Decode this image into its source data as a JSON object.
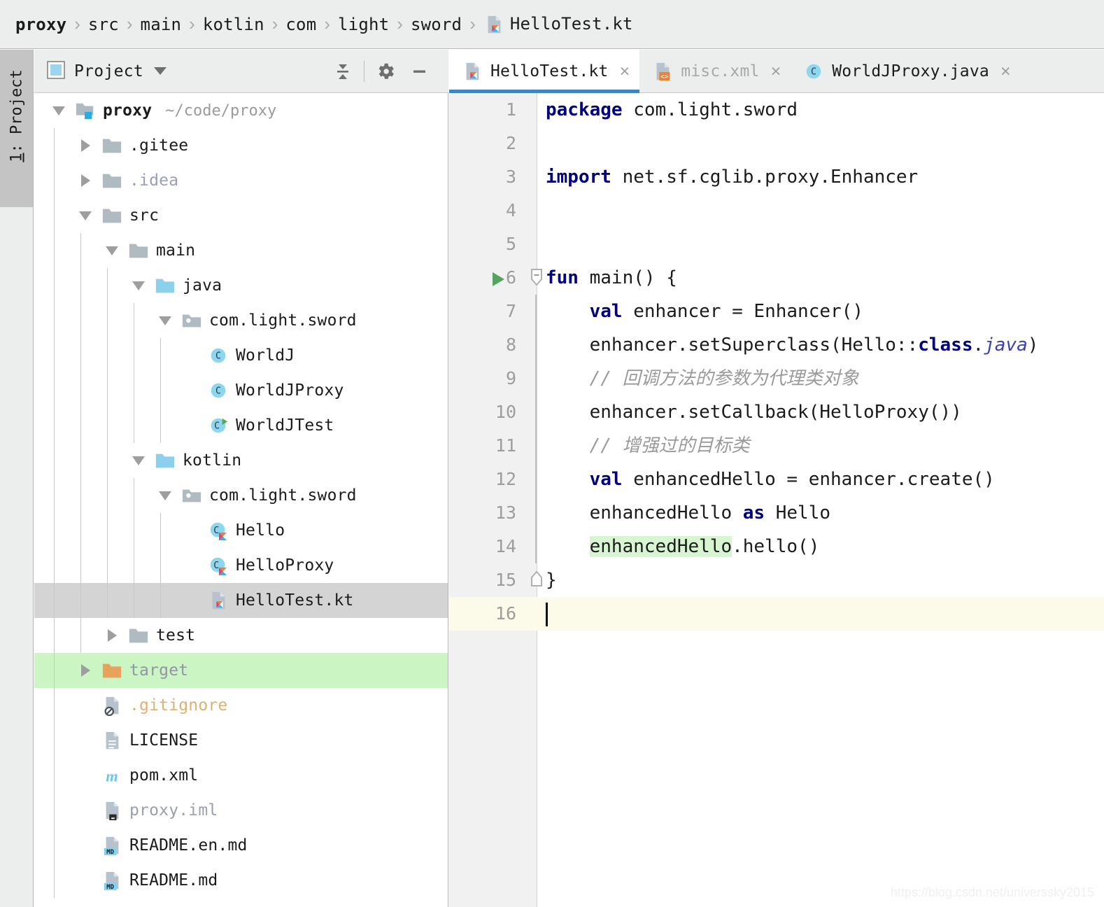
{
  "breadcrumb": {
    "name": "breadcrumb",
    "segments": [
      {
        "label": "proxy",
        "bold": true,
        "icon": null
      },
      {
        "label": "src",
        "bold": false,
        "icon": null
      },
      {
        "label": "main",
        "bold": false,
        "icon": null
      },
      {
        "label": "kotlin",
        "bold": false,
        "icon": null
      },
      {
        "label": "com",
        "bold": false,
        "icon": null
      },
      {
        "label": "light",
        "bold": false,
        "icon": null
      },
      {
        "label": "sword",
        "bold": false,
        "icon": null
      },
      {
        "label": "HelloTest.kt",
        "bold": false,
        "icon": "kotlin-file-icon"
      }
    ],
    "separator": "›"
  },
  "toolstrip": {
    "number": "1",
    "label": ": Project",
    "full_label": "1: Project",
    "icon": "project-folder-icon"
  },
  "project_panel": {
    "title": "Project",
    "view_icon": "project-view-icon",
    "dropdown_icon": "chevron-down-icon",
    "actions": [
      {
        "name": "collapse-all-button",
        "icon": "collapse-all-icon"
      },
      {
        "name": "settings-button",
        "icon": "gear-icon"
      },
      {
        "name": "hide-panel-button",
        "icon": "minimize-icon"
      }
    ]
  },
  "tree": {
    "rows": [
      {
        "label": "proxy",
        "sub": "~/code/proxy",
        "depth": 0,
        "arrow": "down",
        "icon": "module-folder-icon",
        "style": "bold",
        "state": "normal"
      },
      {
        "label": ".gitee",
        "sub": "",
        "depth": 1,
        "arrow": "right",
        "icon": "folder-icon",
        "style": "normal",
        "state": "normal"
      },
      {
        "label": ".idea",
        "sub": "",
        "depth": 1,
        "arrow": "right",
        "icon": "folder-icon",
        "style": "muted",
        "state": "normal"
      },
      {
        "label": "src",
        "sub": "",
        "depth": 1,
        "arrow": "down",
        "icon": "folder-icon",
        "style": "normal",
        "state": "normal"
      },
      {
        "label": "main",
        "sub": "",
        "depth": 2,
        "arrow": "down",
        "icon": "folder-icon",
        "style": "normal",
        "state": "normal"
      },
      {
        "label": "java",
        "sub": "",
        "depth": 3,
        "arrow": "down",
        "icon": "source-folder-icon",
        "style": "normal",
        "state": "normal"
      },
      {
        "label": "com.light.sword",
        "sub": "",
        "depth": 4,
        "arrow": "down",
        "icon": "package-icon",
        "style": "normal",
        "state": "normal"
      },
      {
        "label": "WorldJ",
        "sub": "",
        "depth": 5,
        "arrow": "none",
        "icon": "java-class-icon",
        "style": "normal",
        "state": "normal"
      },
      {
        "label": "WorldJProxy",
        "sub": "",
        "depth": 5,
        "arrow": "none",
        "icon": "java-class-icon",
        "style": "normal",
        "state": "normal"
      },
      {
        "label": "WorldJTest",
        "sub": "",
        "depth": 5,
        "arrow": "none",
        "icon": "java-class-runnable-icon",
        "style": "normal",
        "state": "normal"
      },
      {
        "label": "kotlin",
        "sub": "",
        "depth": 3,
        "arrow": "down",
        "icon": "source-folder-icon",
        "style": "normal",
        "state": "normal"
      },
      {
        "label": "com.light.sword",
        "sub": "",
        "depth": 4,
        "arrow": "down",
        "icon": "package-icon",
        "style": "normal",
        "state": "normal"
      },
      {
        "label": "Hello",
        "sub": "",
        "depth": 5,
        "arrow": "none",
        "icon": "kotlin-class-icon",
        "style": "normal",
        "state": "normal"
      },
      {
        "label": "HelloProxy",
        "sub": "",
        "depth": 5,
        "arrow": "none",
        "icon": "kotlin-class-icon",
        "style": "normal",
        "state": "normal"
      },
      {
        "label": "HelloTest.kt",
        "sub": "",
        "depth": 5,
        "arrow": "none",
        "icon": "kotlin-file-icon",
        "style": "normal",
        "state": "selected"
      },
      {
        "label": "test",
        "sub": "",
        "depth": 2,
        "arrow": "right",
        "icon": "folder-icon",
        "style": "normal",
        "state": "normal"
      },
      {
        "label": "target",
        "sub": "",
        "depth": 1,
        "arrow": "right",
        "icon": "excluded-folder-icon",
        "style": "gray-purple",
        "state": "vcs-green"
      },
      {
        "label": ".gitignore",
        "sub": "",
        "depth": 1,
        "arrow": "none",
        "icon": "gitignore-file-icon",
        "style": "tan",
        "state": "normal"
      },
      {
        "label": "LICENSE",
        "sub": "",
        "depth": 1,
        "arrow": "none",
        "icon": "text-file-icon",
        "style": "normal",
        "state": "normal"
      },
      {
        "label": "pom.xml",
        "sub": "",
        "depth": 1,
        "arrow": "none",
        "icon": "maven-file-icon",
        "style": "normal",
        "state": "normal"
      },
      {
        "label": "proxy.iml",
        "sub": "",
        "depth": 1,
        "arrow": "none",
        "icon": "iml-file-icon",
        "style": "muted",
        "state": "normal"
      },
      {
        "label": "README.en.md",
        "sub": "",
        "depth": 1,
        "arrow": "none",
        "icon": "markdown-file-icon",
        "style": "normal",
        "state": "normal"
      },
      {
        "label": "README.md",
        "sub": "",
        "depth": 1,
        "arrow": "none",
        "icon": "markdown-file-icon",
        "style": "normal",
        "state": "normal"
      }
    ]
  },
  "editor": {
    "tabs": [
      {
        "label": "HelloTest.kt",
        "icon": "kotlin-file-icon",
        "active": true,
        "muted": false,
        "close": "×"
      },
      {
        "label": "misc.xml",
        "icon": "xml-file-icon",
        "active": false,
        "muted": true,
        "close": "×"
      },
      {
        "label": "WorldJProxy.java",
        "icon": "java-class-icon",
        "active": false,
        "muted": false,
        "close": "×"
      }
    ],
    "active_file": "HelloTest.kt",
    "caret_line": 16,
    "lines": [
      {
        "n": "1",
        "run": false,
        "fold": "none",
        "html": "<span class='kw'>package</span> com.light.sword"
      },
      {
        "n": "2",
        "run": false,
        "fold": "none",
        "html": ""
      },
      {
        "n": "3",
        "run": false,
        "fold": "none",
        "html": "<span class='kw'>import</span> net.sf.cglib.proxy.Enhancer"
      },
      {
        "n": "4",
        "run": false,
        "fold": "none",
        "html": ""
      },
      {
        "n": "5",
        "run": false,
        "fold": "none",
        "html": ""
      },
      {
        "n": "6",
        "run": true,
        "fold": "open",
        "html": "<span class='kw'>fun</span> main() {"
      },
      {
        "n": "7",
        "run": false,
        "fold": "line",
        "html": "    <span class='kw'>val</span> enhancer = Enhancer()"
      },
      {
        "n": "8",
        "run": false,
        "fold": "line",
        "html": "    enhancer.setSuperclass(Hello::<span class='kw'>class</span>.<span class='jfield'>java</span>)"
      },
      {
        "n": "9",
        "run": false,
        "fold": "line",
        "html": "    <span class='cmt'>// 回调方法的参数为代理类对象</span>"
      },
      {
        "n": "10",
        "run": false,
        "fold": "line",
        "html": "    enhancer.setCallback(HelloProxy())"
      },
      {
        "n": "11",
        "run": false,
        "fold": "line",
        "html": "    <span class='cmt'>// 增强过的目标类</span>"
      },
      {
        "n": "12",
        "run": false,
        "fold": "line",
        "html": "    <span class='kw'>val</span> enhancedHello = enhancer.create()"
      },
      {
        "n": "13",
        "run": false,
        "fold": "line",
        "html": "    enhancedHello <span class='kw'>as</span> Hello"
      },
      {
        "n": "14",
        "run": false,
        "fold": "line",
        "html": "    <span class='hl'>enhancedHello</span>.hello()"
      },
      {
        "n": "15",
        "run": false,
        "fold": "close",
        "html": "}"
      },
      {
        "n": "16",
        "run": false,
        "fold": "none",
        "html": ""
      }
    ],
    "plain_text": "package com.light.sword\n\nimport net.sf.cglib.proxy.Enhancer\n\n\nfun main() {\n    val enhancer = Enhancer()\n    enhancer.setSuperclass(Hello::class.java)\n    // 回调方法的参数为代理类对象\n    enhancer.setCallback(HelloProxy())\n    // 增强过的目标类\n    val enhancedHello = enhancer.create()\n    enhancedHello as Hello\n    enhancedHello.hello()\n}\n"
  },
  "watermark": {
    "text": "https://blog.csdn.net/universsky2015"
  },
  "colors": {
    "chrome": "#eceded",
    "accent_blue": "#4184c4",
    "keyword": "#000080",
    "comment": "#9a9a9a",
    "selection": "#d4d4d4",
    "vcs_added": "#ccf5c4",
    "usage_highlight": "#d6f5d0",
    "caret_line": "#fcfae8",
    "kotlin_orange": "#e8833a",
    "source_folder": "#8cd0ee"
  }
}
